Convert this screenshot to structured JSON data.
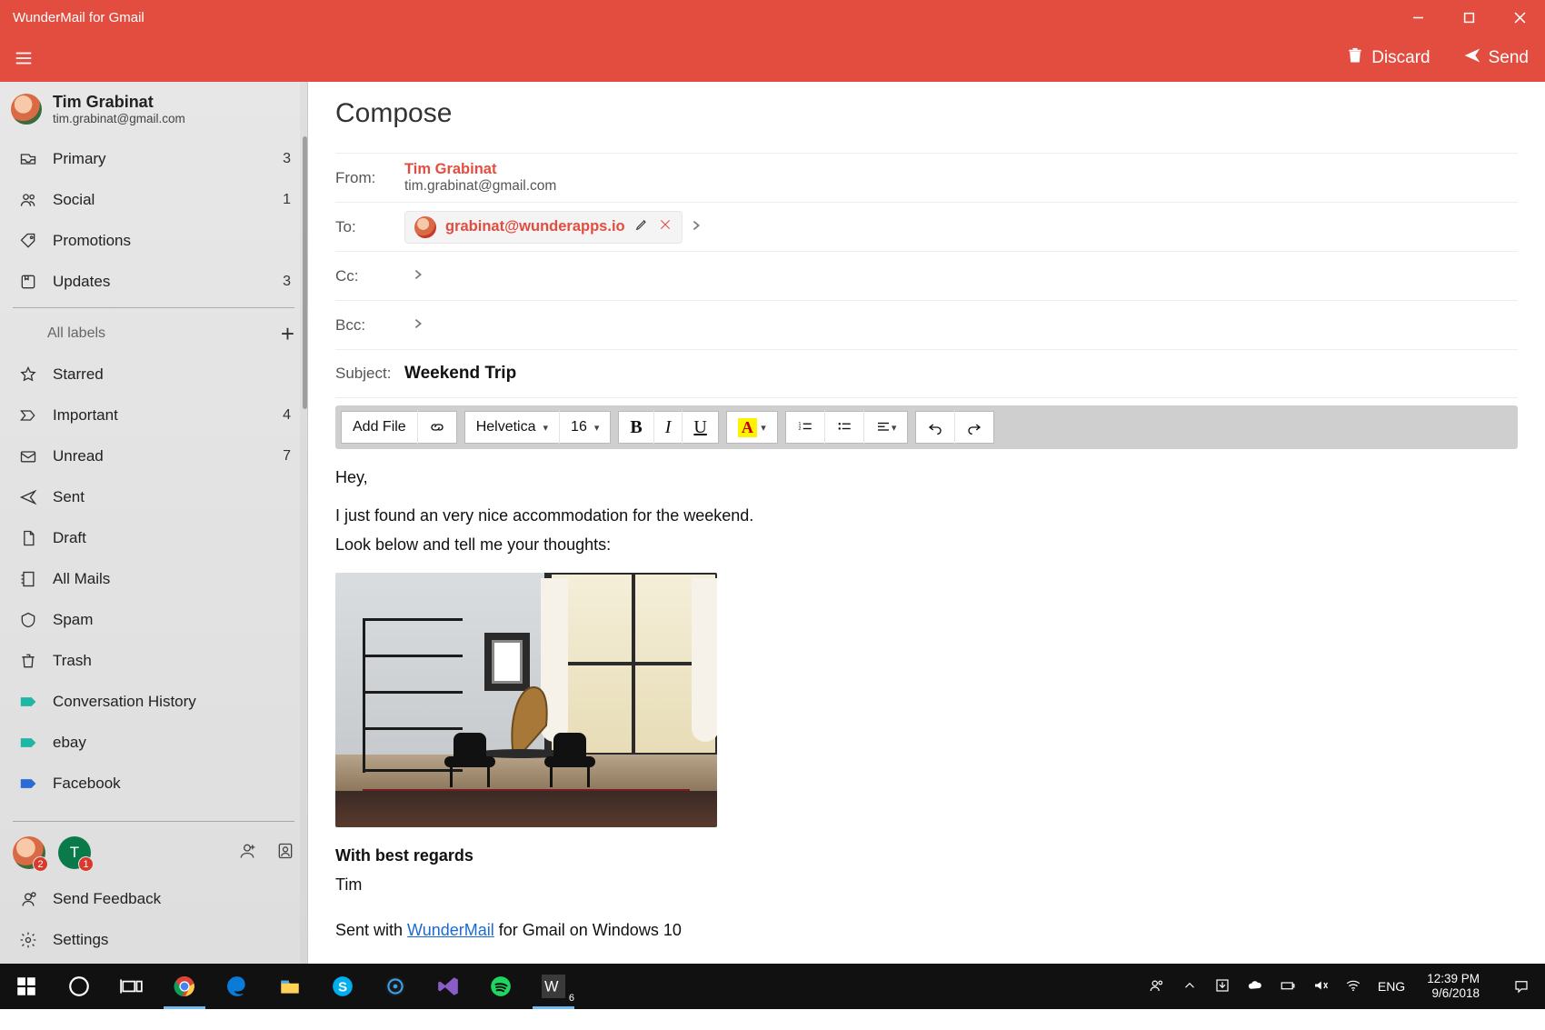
{
  "window": {
    "title": "WunderMail for Gmail"
  },
  "actionbar": {
    "discard": "Discard",
    "send": "Send"
  },
  "account": {
    "name": "Tim Grabinat",
    "email": "tim.grabinat@gmail.com"
  },
  "sidebar": {
    "items": [
      {
        "icon": "inbox",
        "label": "Primary",
        "count": "3"
      },
      {
        "icon": "social",
        "label": "Social",
        "count": "1"
      },
      {
        "icon": "tag",
        "label": "Promotions",
        "count": ""
      },
      {
        "icon": "updates",
        "label": "Updates",
        "count": "3"
      }
    ],
    "all_labels": "All labels",
    "labels": [
      {
        "icon": "star",
        "label": "Starred",
        "count": ""
      },
      {
        "icon": "important",
        "label": "Important",
        "count": "4"
      },
      {
        "icon": "mail",
        "label": "Unread",
        "count": "7"
      },
      {
        "icon": "sent",
        "label": "Sent",
        "count": ""
      },
      {
        "icon": "draft",
        "label": "Draft",
        "count": ""
      },
      {
        "icon": "allmail",
        "label": "All Mails",
        "count": ""
      },
      {
        "icon": "spam",
        "label": "Spam",
        "count": ""
      },
      {
        "icon": "trash",
        "label": "Trash",
        "count": ""
      },
      {
        "icon": "label-teal",
        "label": "Conversation History",
        "count": ""
      },
      {
        "icon": "label-teal",
        "label": "ebay",
        "count": ""
      },
      {
        "icon": "label-blue",
        "label": "Facebook",
        "count": ""
      }
    ],
    "chip1_badge": "2",
    "chip2_letter": "T",
    "chip2_badge": "1",
    "feedback": "Send Feedback",
    "settings": "Settings"
  },
  "compose": {
    "title": "Compose",
    "from_label": "From:",
    "from_name": "Tim Grabinat",
    "from_email": "tim.grabinat@gmail.com",
    "to_label": "To:",
    "to_addr": "grabinat@wunderapps.io",
    "cc_label": "Cc:",
    "bcc_label": "Bcc:",
    "subject_label": "Subject:",
    "subject": "Weekend Trip",
    "toolbar": {
      "add_file": "Add File",
      "font": "Helvetica",
      "size": "16",
      "color_letter": "A"
    },
    "body": {
      "greeting": "Hey,",
      "line1": "I just found an very nice accommodation for the weekend.",
      "line2": "Look below and tell me your thoughts:",
      "regards": "With best regards",
      "signature": "Tim",
      "sent_prefix": "Sent with ",
      "sent_link": "WunderMail",
      "sent_suffix": " for Gmail on Windows 10"
    }
  },
  "taskbar": {
    "lang": "ENG",
    "time": "12:39 PM",
    "date": "9/6/2018",
    "w_badge": "6"
  }
}
